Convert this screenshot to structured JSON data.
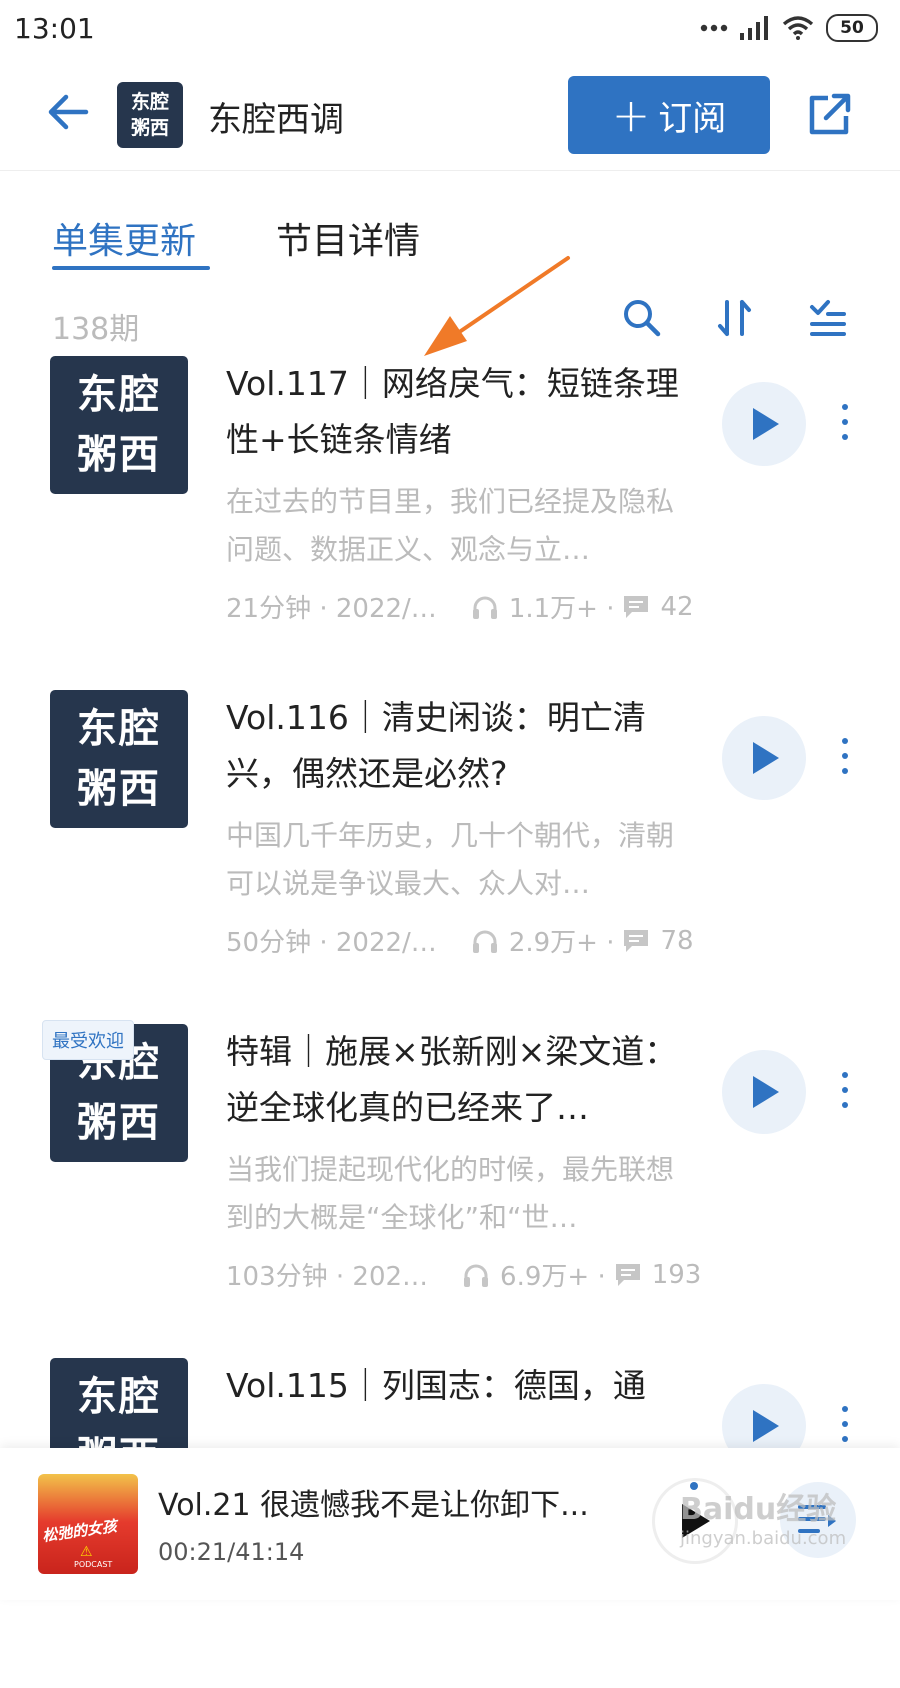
{
  "status_bar": {
    "time": "13:01",
    "battery": "50"
  },
  "header": {
    "podcast_name": "东腔西调",
    "logo_line1": "东腔",
    "logo_line2": "粥西",
    "subscribe_label": "订阅"
  },
  "tabs": [
    {
      "label": "单集更新",
      "active": true
    },
    {
      "label": "节目详情",
      "active": false
    }
  ],
  "episode_count": "138期",
  "episodes": [
    {
      "cover_line1": "东腔",
      "cover_line2": "粥西",
      "badge": "",
      "title": "Vol.117｜网络戾气：短链条理性+长链条情绪",
      "description": "在过去的节目里，我们已经提及隐私问题、数据正义、观念与立…",
      "duration_date": "21分钟 · 2022/…",
      "plays": "1.1万+ ·",
      "comments": "42"
    },
    {
      "cover_line1": "东腔",
      "cover_line2": "粥西",
      "badge": "",
      "title": "Vol.116｜清史闲谈：明亡清兴，偶然还是必然?",
      "description": "中国几千年历史，几十个朝代，清朝可以说是争议最大、众人对…",
      "duration_date": "50分钟 · 2022/…",
      "plays": "2.9万+ ·",
      "comments": "78"
    },
    {
      "cover_line1": "东腔",
      "cover_line2": "粥西",
      "badge": "最受欢迎",
      "title": "特辑｜施展×张新刚×梁文道：逆全球化真的已经来了…",
      "description": "当我们提起现代化的时候，最先联想到的大概是“全球化”和“世…",
      "duration_date": "103分钟 · 202…",
      "plays": "6.9万+ ·",
      "comments": "193"
    },
    {
      "cover_line1": "东腔",
      "cover_line2": "粥西",
      "badge": "",
      "title": "Vol.115｜列国志：德国，通",
      "description": "",
      "duration_date": "",
      "plays": "",
      "comments": ""
    }
  ],
  "player": {
    "title": "Vol.21 很遗憾我不是让你卸下...",
    "time": "00:21/41:14",
    "cover_text": "松弛的女孩",
    "cover_sub": "PODCAST"
  },
  "watermark": {
    "brand": "Baidu经验",
    "url": "jingyan.baidu.com"
  },
  "colors": {
    "accent": "#2f73c2",
    "cover_bg": "#26364d",
    "muted": "#bbbbbb",
    "annotation_arrow": "#f07a28"
  }
}
